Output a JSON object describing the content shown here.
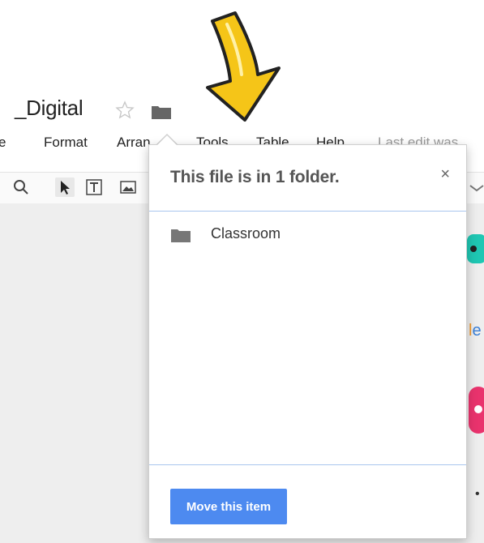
{
  "doc": {
    "title": "_Digital"
  },
  "menu": {
    "items": [
      "e",
      "Format",
      "Arran",
      "Tools",
      "Table",
      "Help",
      "Last edit was"
    ]
  },
  "popup": {
    "title": "This file is in 1 folder.",
    "close_symbol": "×",
    "folders": [
      {
        "name": "Classroom",
        "icon": "folder-icon"
      }
    ],
    "move_button_label": "Move this item"
  },
  "colors": {
    "accent": "#4d8af0",
    "arrow": "#f5c518",
    "divider": "#a9c6ee"
  }
}
